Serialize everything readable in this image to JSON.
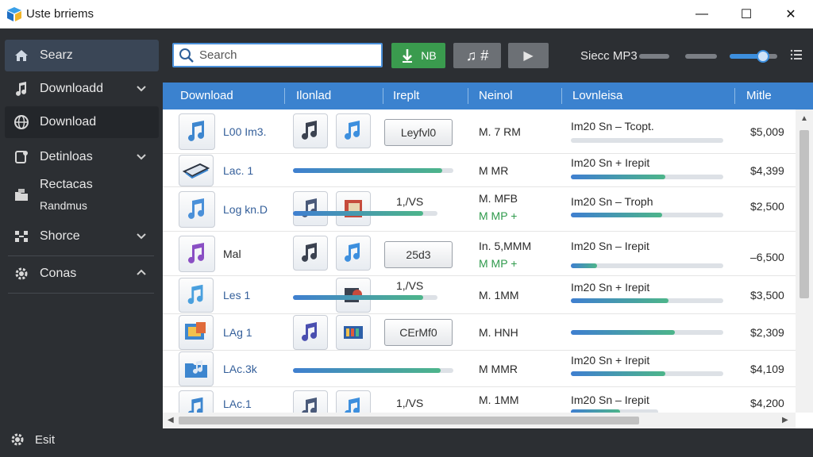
{
  "window": {
    "title": "Uste brriems",
    "minimize_glyph": "—",
    "maximize_glyph": "☐",
    "close_glyph": "✕"
  },
  "sidebar": {
    "items": [
      {
        "label": "Searz",
        "icon": "home-icon"
      },
      {
        "label": "Downloadd",
        "icon": "music-note-icon"
      },
      {
        "label": "Download",
        "icon": "globe-icon"
      },
      {
        "label": "Detinloas",
        "icon": "document-icon"
      },
      {
        "label": "Rectacas",
        "sublabel": "Randmus",
        "icon": "folder-icon"
      },
      {
        "label": "Shorce",
        "icon": "share-icon"
      },
      {
        "label": "Conas",
        "icon": "gear-icon"
      }
    ],
    "footer": {
      "label": "Esit",
      "icon": "gear-icon"
    }
  },
  "toolbar": {
    "search_placeholder": "Search",
    "green_button_label": "NB",
    "gray_button_label": "♫ #",
    "play_glyph": "▶",
    "select_label": "Siecc MP3",
    "volume_level": 0.7,
    "menu_icon": "menu-icon"
  },
  "table": {
    "headers": [
      "Download",
      "Ilonlad",
      "Ireplt",
      "Neinol",
      "Lovnleisa",
      "Mitle"
    ],
    "rows": [
      {
        "name": "L00 Im3.",
        "col2": "",
        "pill": "Leyfvl0",
        "size": "M. 7 RM",
        "size2": "",
        "desc": "Im20 Sn – Tcopt.",
        "progress": 0.0,
        "progress2": 0.0,
        "price": "$5,009"
      },
      {
        "name": "Lac. 1",
        "col2": "",
        "pill": "",
        "size": "M MR",
        "size2": "",
        "desc": "Im20 Sn + Irepit",
        "progress": 0.93,
        "progress2": 0.62,
        "price": "$4,399"
      },
      {
        "name": "Log kn.D",
        "col2": "1,/VS",
        "pill": "",
        "size": "M. MFB",
        "size2": "M MP +",
        "desc": "Im20 Sn – Troph",
        "progress": 0.9,
        "progress2": 0.6,
        "price": "$2,500"
      },
      {
        "name": "Mal",
        "col2": "",
        "pill": "25d3",
        "size": "In. 5,MMM",
        "size2": "M MP +",
        "desc": "Im20 Sn – Irepit",
        "progress": 0.0,
        "progress2": 0.17,
        "price": "–6,500"
      },
      {
        "name": "Les 1",
        "col2": "1,/VS",
        "pill": "",
        "size": "M. 1MM",
        "size2": "",
        "desc": "Im20 Sn + Irepit",
        "progress": 0.9,
        "progress2": 0.64,
        "price": "$3,500"
      },
      {
        "name": "LAg 1",
        "col2": "",
        "pill": "CErMf0",
        "size": "M. HNH",
        "size2": "",
        "desc": "",
        "progress": 0.0,
        "progress2": 0.68,
        "price": "$2,309"
      },
      {
        "name": "LAc.3k",
        "col2": "",
        "pill": "",
        "size": "M MMR",
        "size2": "",
        "desc": "Im20 Sn + Irepit",
        "progress": 0.92,
        "progress2": 0.62,
        "price": "$4,109"
      },
      {
        "name": "LAc.1",
        "col2": "1,/VS",
        "pill": "",
        "size": "M. 1MM",
        "size2": "",
        "desc": "Im20 Sn – Irepit",
        "progress": 0.0,
        "progress2": 0.56,
        "price": "$4,200"
      }
    ]
  }
}
